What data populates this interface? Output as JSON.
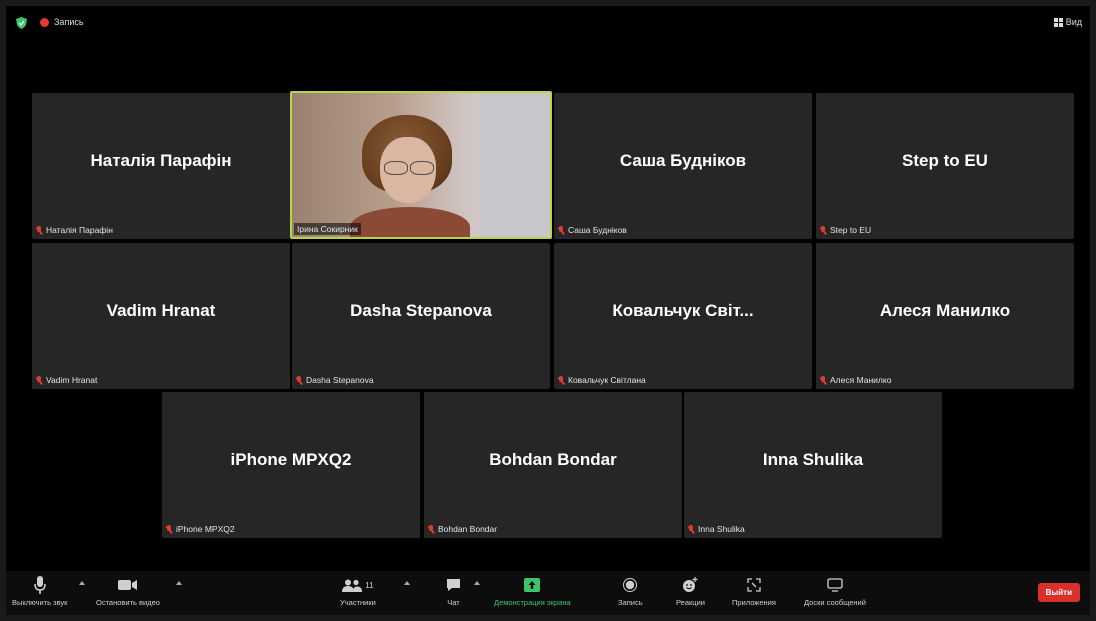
{
  "topbar": {
    "record_label": "Запись",
    "view_label": "Вид"
  },
  "participants": [
    {
      "display": "Наталія Парафін",
      "tag": "Наталія Парафін",
      "video": false,
      "active": false
    },
    {
      "display": "",
      "tag": "Ірина Сокирник",
      "video": true,
      "active": true
    },
    {
      "display": "Саша Будніков",
      "tag": "Саша Будніков",
      "video": false,
      "active": false
    },
    {
      "display": "Step to EU",
      "tag": "Step to EU",
      "video": false,
      "active": false
    },
    {
      "display": "Vadim Hranat",
      "tag": "Vadim Hranat",
      "video": false,
      "active": false
    },
    {
      "display": "Dasha Stepanova",
      "tag": "Dasha Stepanova",
      "video": false,
      "active": false
    },
    {
      "display": "Ковальчук Світ...",
      "tag": "Ковальчук Світлана",
      "video": false,
      "active": false
    },
    {
      "display": "Алеся Манилко",
      "tag": "Алеся Манилко",
      "video": false,
      "active": false
    },
    {
      "display": "iPhone MPXQ2",
      "tag": "iPhone MPXQ2",
      "video": false,
      "active": false
    },
    {
      "display": "Bohdan Bondar",
      "tag": "Bohdan Bondar",
      "video": false,
      "active": false
    },
    {
      "display": "Inna Shulika",
      "tag": "Inna Shulika",
      "video": false,
      "active": false
    }
  ],
  "toolbar": {
    "mute": "Выключить звук",
    "stop_video": "Остановить видео",
    "participants": "Участники",
    "participants_count": "11",
    "chat": "Чат",
    "share": "Демонстрация экрана",
    "record": "Запись",
    "reactions": "Реакции",
    "apps": "Приложения",
    "whiteboards": "Доски сообщений",
    "leave": "Выйти"
  },
  "colors": {
    "active_border": "#b9d34a",
    "share_green": "#3cc36b",
    "leave_red": "#d9302c",
    "mute_red": "#e03b33"
  },
  "icons": [
    "shield-icon",
    "record-dot-icon",
    "grid-view-icon",
    "microphone-icon",
    "video-camera-icon",
    "participants-icon",
    "chat-icon",
    "share-screen-icon",
    "record-icon",
    "reactions-icon",
    "apps-icon",
    "whiteboard-icon",
    "mic-muted-icon"
  ]
}
